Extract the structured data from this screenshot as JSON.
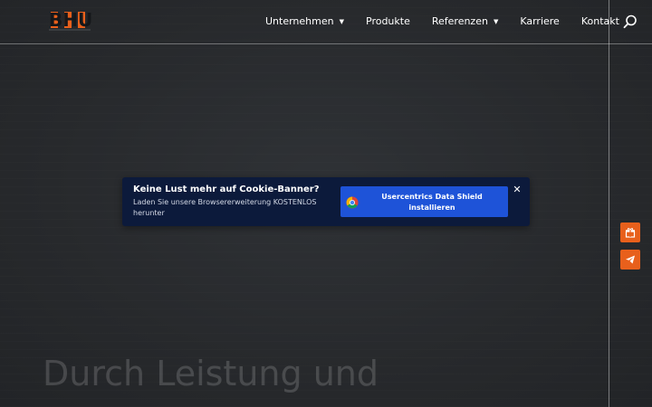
{
  "header": {
    "logo_text": "BHU",
    "nav": [
      {
        "label": "Unternehmen",
        "has_dropdown": true
      },
      {
        "label": "Produkte",
        "has_dropdown": false
      },
      {
        "label": "Referenzen",
        "has_dropdown": true
      },
      {
        "label": "Karriere",
        "has_dropdown": false
      },
      {
        "label": "Kontakt",
        "has_dropdown": false
      }
    ],
    "search_icon": "search-icon"
  },
  "side_actions": [
    {
      "icon": "gift-icon"
    },
    {
      "icon": "paper-plane-icon"
    }
  ],
  "hero": {
    "headline_line1": "Durch Leistung und"
  },
  "cookie_banner": {
    "title": "Keine Lust mehr auf Cookie-Banner?",
    "description": "Laden Sie unsere Browsererweiterung KOSTENLOS herunter",
    "button_label": "Usercentrics Data Shield installieren",
    "button_icon": "chrome-icon",
    "close_icon": "close-icon"
  },
  "colors": {
    "accent": "#e8601c",
    "banner_bg": "#0c1a3b",
    "button_bg": "#1e53d8"
  }
}
